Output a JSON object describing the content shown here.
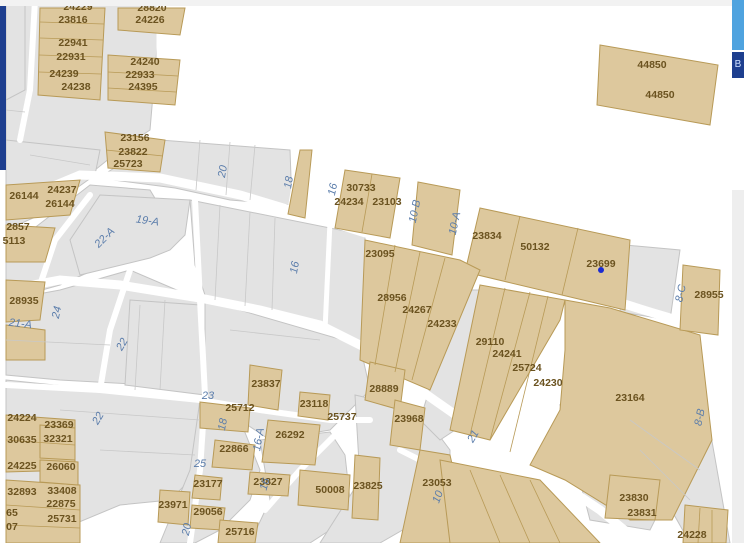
{
  "map": {
    "parcel_labels": [
      "24229",
      "28820",
      "23816",
      "24226",
      "22941",
      "22931",
      "24240",
      "22933",
      "24239",
      "24238",
      "24395",
      "23156",
      "23822",
      "25723",
      "44850",
      "44850",
      "30733",
      "24234",
      "23103",
      "26144",
      "24237",
      "26144",
      "23834",
      "50132",
      "23699",
      "2857",
      "5113",
      "23095",
      "28956",
      "24267",
      "24233",
      "28935",
      "29110",
      "24241",
      "25724",
      "24230",
      "23164",
      "28955",
      "23837",
      "28889",
      "23118",
      "23968",
      "24224",
      "23369",
      "32321",
      "30635",
      "25712",
      "25737",
      "26292",
      "22866",
      "24225",
      "26060",
      "23177",
      "23827",
      "50008",
      "23825",
      "23053",
      "32893",
      "33408",
      "22875",
      "25731",
      "65",
      "07",
      "23971",
      "29056",
      "25716",
      "23830",
      "23831",
      "24228"
    ],
    "street_labels": [
      "20",
      "18",
      "16",
      "10-B",
      "10-A",
      "19-A",
      "22-A",
      "16",
      "8-C",
      "24",
      "21-A",
      "22",
      "23",
      "18",
      "16-A",
      "22",
      "25",
      "16",
      "21",
      "10",
      "20",
      "8-B"
    ]
  },
  "ui": {
    "left_rail_icon": "panel-edge",
    "right_button_glyph": "B"
  },
  "colors": {
    "parcel_fill": "#ddc89d",
    "parcel_stroke": "#b89a57",
    "block_fill": "#e3e3e3",
    "road": "#ffffff",
    "label_text": "#6b5320",
    "street_text": "#5b7dab",
    "accent_dark_blue": "#1e3f8f",
    "accent_light_blue": "#4fa3df",
    "marker": "#1b2bd1"
  }
}
